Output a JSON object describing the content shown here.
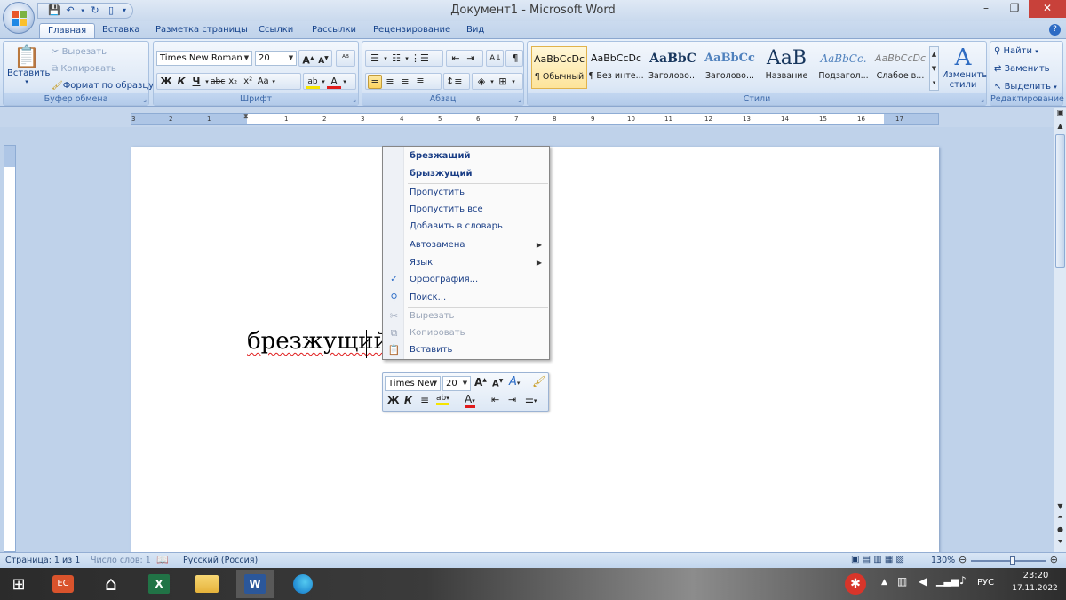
{
  "window": {
    "title": "Документ1 - Microsoft Word",
    "controls": [
      "–",
      "❐",
      "✕"
    ]
  },
  "tabs": [
    "Главная",
    "Вставка",
    "Разметка страницы",
    "Ссылки",
    "Рассылки",
    "Рецензирование",
    "Вид"
  ],
  "ribbon": {
    "clipboard": {
      "label": "Буфер обмена",
      "paste": "Вставить",
      "cut": "Вырезать",
      "copy": "Копировать",
      "format_painter": "Формат по образцу"
    },
    "font": {
      "label": "Шрифт",
      "font_name": "Times New Roman",
      "font_size": "20",
      "bold": "Ж",
      "italic": "К",
      "underline": "Ч",
      "strike": "abc",
      "subscript": "x₂",
      "superscript": "x²",
      "case": "Aa"
    },
    "paragraph": {
      "label": "Абзац"
    },
    "styles": {
      "label": "Стили",
      "items": [
        {
          "preview": "AaBbCcDc",
          "name": "¶ Обычный"
        },
        {
          "preview": "AaBbCcDc",
          "name": "¶ Без инте..."
        },
        {
          "preview": "AaBbC",
          "name": "Заголово..."
        },
        {
          "preview": "AaBbCc",
          "name": "Заголово..."
        },
        {
          "preview": "AaB",
          "name": "Название"
        },
        {
          "preview": "AaBbCc.",
          "name": "Подзагол..."
        },
        {
          "preview": "AaBbCcDc",
          "name": "Слабое в..."
        }
      ],
      "change_styles": "Изменить стили"
    },
    "editing": {
      "label": "Редактирование",
      "find": "Найти",
      "replace": "Заменить",
      "select": "Выделить"
    }
  },
  "ruler_ticks": [
    "3",
    "2",
    "1",
    "1",
    "2",
    "3",
    "4",
    "5",
    "6",
    "7",
    "8",
    "9",
    "10",
    "11",
    "12",
    "13",
    "14",
    "15",
    "16",
    "17"
  ],
  "document": {
    "text": "брезжущий"
  },
  "context_menu": {
    "suggestions": [
      "брезжащий",
      "брызжущий"
    ],
    "items": [
      {
        "label": "Пропустить",
        "disabled": false
      },
      {
        "label": "Пропустить все",
        "disabled": false
      },
      {
        "label": "Добавить в словарь",
        "disabled": false
      },
      {
        "label": "Автозамена",
        "submenu": true
      },
      {
        "label": "Язык",
        "submenu": true
      },
      {
        "label": "Орфография...",
        "icon": "spelling-icon"
      },
      {
        "label": "Поиск...",
        "icon": "research-icon"
      },
      {
        "label": "Вырезать",
        "disabled": true,
        "icon": "scissors-icon"
      },
      {
        "label": "Копировать",
        "disabled": true,
        "icon": "copy-icon"
      },
      {
        "label": "Вставить",
        "disabled": false,
        "icon": "paste-icon"
      }
    ]
  },
  "mini_toolbar": {
    "font_name": "Times New",
    "font_size": "20"
  },
  "status_bar": {
    "page": "Страница: 1 из 1",
    "words": "Число слов: 1",
    "language": "Русский (Россия)",
    "zoom": "130%"
  },
  "taskbar": {
    "lang": "РУС",
    "time": "23:20",
    "date": "17.11.2022"
  },
  "colors": {
    "ribbon_text": "#15428b",
    "active_tab": "#ffffff",
    "spelling_underline": "#e01c1c",
    "close_button": "#c8413a"
  }
}
